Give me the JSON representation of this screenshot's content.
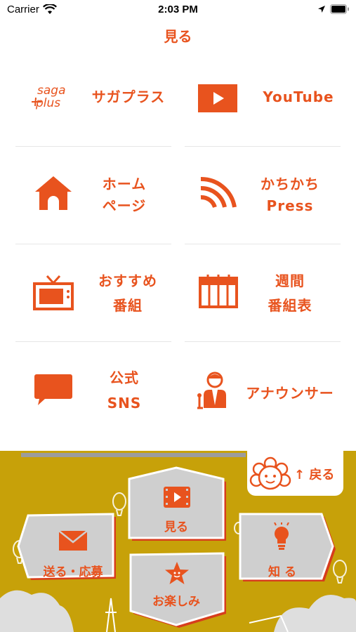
{
  "status_bar": {
    "carrier": "Carrier",
    "time": "2:03 PM"
  },
  "page_title": "見る",
  "tiles": [
    {
      "line1": "サガプラス",
      "logo_text_1": "saga",
      "logo_text_2": "plus"
    },
    {
      "line1": "YouTube"
    },
    {
      "line1": "ホーム",
      "line2": "ページ"
    },
    {
      "line1": "かちかち",
      "line2": "Press"
    },
    {
      "line1": "おすすめ",
      "line2": "番組"
    },
    {
      "line1": "週間",
      "line2": "番組表"
    },
    {
      "line1": "公式",
      "line2": "SNS"
    },
    {
      "line1": "アナウンサー"
    }
  ],
  "bottom_nav": {
    "back_label": "↑ 戻る",
    "watch_label": "見る",
    "send_label": "送る・応募",
    "know_label": "知 る",
    "enjoy_label": "お楽しみ"
  },
  "colors": {
    "accent": "#e8531e",
    "panel": "#c7a109",
    "card": "#cfcfcf"
  }
}
